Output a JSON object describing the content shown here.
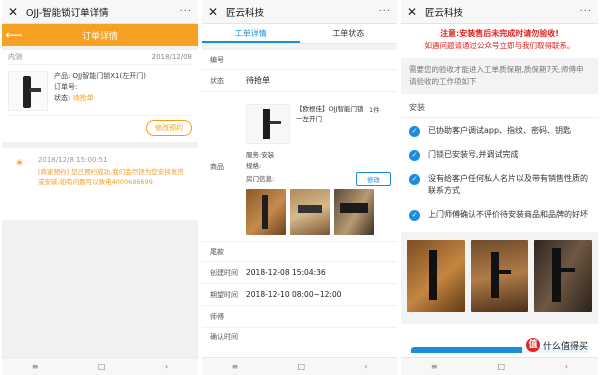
{
  "panel1": {
    "window_title": "OJJ-智能锁订单详情",
    "header_title": "订单详情",
    "meta_left": "内测",
    "meta_date": "2018/12/08",
    "product_line": "产品: OJJ智能门锁X1(左开门)",
    "order_no_label": "订单号:",
    "status_label": "状态:",
    "status_value": "待抢单",
    "modify_button": "修改预约",
    "tl_time": "2018/12/8 15:00:51",
    "tl_text": "[商家预约] 您已预约成功,我们会尽快为您安排发货或安装,如有问题可以致电4000686699"
  },
  "panel2": {
    "window_title": "匠云科技",
    "tab_detail": "工单详情",
    "tab_status": "工单状态",
    "label_no": "编号",
    "label_status": "状态",
    "status_value": "待抢单",
    "label_goods": "商品",
    "goods_title": "【欧根佳】OJJ智能门锁一左开门",
    "goods_qty": "1件",
    "service_line": "服务:安装",
    "spec_line": "规格:",
    "door_info": "房门信息:",
    "edit_button": "修改",
    "label_tail": "尾款",
    "label_created": "创建时间",
    "created_value": "2018-12-08 15:04:36",
    "label_expect": "期望时间",
    "expect_value": "2018-12-10 08:00~12:00",
    "label_worker": "师傅",
    "label_confirm": "确认时间"
  },
  "panel3": {
    "window_title": "匠云科技",
    "warn_line1": "注意:安装售后未完成时请勿验收!",
    "warn_line2": "如遇问题请通过公众号立即与我们取得联系。",
    "gray_text": "需要您的验收才能进入工单质保期,质保期7天,师傅申请验收的工作项如下",
    "section_title": "安装",
    "checks": [
      "已协助客户调试app、指纹、密码、钥匙",
      "门锁已安装号,并调试完成",
      "没有给客户任何私人名片以及带有销售性质的联系方式",
      "上门师傅确认不评价待安装商品和品牌的好坏"
    ],
    "check_glyph": "✓",
    "watermark_badge": "值",
    "watermark_text": "什么值得买"
  },
  "nav": {
    "menu": "≡",
    "home": "□",
    "back": "‹"
  },
  "colors": {
    "orange": "#f6a024",
    "blue": "#1a8ddc",
    "red": "#e0201b"
  }
}
